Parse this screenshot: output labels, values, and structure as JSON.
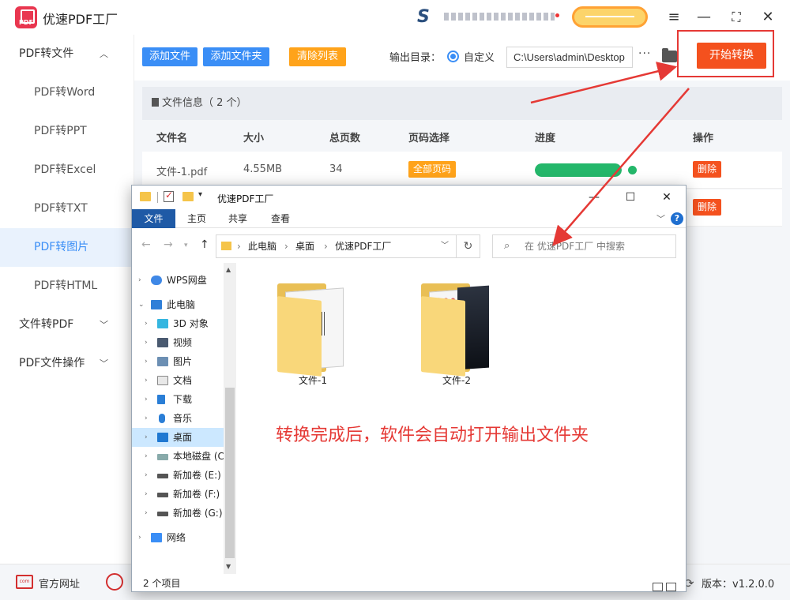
{
  "app": {
    "title": "优速PDF工厂",
    "version_label": "版本：v1.2.0.0"
  },
  "sidebar": {
    "groups": [
      {
        "label": "PDF转文件",
        "expanded": true
      },
      {
        "label": "文件转PDF",
        "expanded": false
      },
      {
        "label": "PDF文件操作",
        "expanded": false
      }
    ],
    "items": [
      "PDF转Word",
      "PDF转PPT",
      "PDF转Excel",
      "PDF转TXT",
      "PDF转图片",
      "PDF转HTML"
    ],
    "active_item": "PDF转图片"
  },
  "toolbar": {
    "add_file": "添加文件",
    "add_folder": "添加文件夹",
    "clear_list": "清除列表",
    "output_label": "输出目录：",
    "radio_label": "自定义",
    "output_path": "C:\\Users\\admin\\Desktop",
    "more": "···",
    "start": "开始转换"
  },
  "file_info": {
    "header": "文件信息（ 2 个）",
    "columns": [
      "文件名",
      "大小",
      "总页数",
      "页码选择",
      "进度",
      "操作"
    ],
    "rows": [
      {
        "name": "文件-1.pdf",
        "size": "4.55MB",
        "pages": "34",
        "page_select": "全部页码",
        "progress": 1.0,
        "action": "删除"
      },
      {
        "action": "删除"
      }
    ]
  },
  "footer": {
    "website": "官方网址"
  },
  "explorer": {
    "title": "优速PDF工厂",
    "ribbon_tabs": [
      "文件",
      "主页",
      "共享",
      "查看"
    ],
    "breadcrumb": [
      "此电脑",
      "桌面",
      "优速PDF工厂"
    ],
    "search_placeholder": "在 优速PDF工厂 中搜索",
    "tree": [
      {
        "label": "WPS网盘",
        "level": 0,
        "icon": "cloud-icon"
      },
      {
        "label": "此电脑",
        "level": 0,
        "icon": "computer-icon",
        "expanded": true
      },
      {
        "label": "3D 对象",
        "level": 1,
        "icon": "3d-objects-icon"
      },
      {
        "label": "视频",
        "level": 1,
        "icon": "video-icon"
      },
      {
        "label": "图片",
        "level": 1,
        "icon": "pictures-icon"
      },
      {
        "label": "文档",
        "level": 1,
        "icon": "documents-icon"
      },
      {
        "label": "下载",
        "level": 1,
        "icon": "download-icon"
      },
      {
        "label": "音乐",
        "level": 1,
        "icon": "music-icon"
      },
      {
        "label": "桌面",
        "level": 1,
        "icon": "desktop-icon",
        "selected": true
      },
      {
        "label": "本地磁盘 (C",
        "level": 1,
        "icon": "drive-c-icon"
      },
      {
        "label": "新加卷 (E:)",
        "level": 1,
        "icon": "drive-icon"
      },
      {
        "label": "新加卷 (F:)",
        "level": 1,
        "icon": "drive-icon"
      },
      {
        "label": "新加卷 (G:)",
        "level": 1,
        "icon": "drive-icon"
      },
      {
        "label": "网络",
        "level": 0,
        "icon": "network-icon"
      }
    ],
    "folders": [
      "文件-1",
      "文件-2"
    ],
    "annotation": "转换完成后，软件会自动打开输出文件夹",
    "status": "2 个项目"
  },
  "colors": {
    "accent_blue": "#3a8ef6",
    "orange": "#ffa31a",
    "start_red": "#f4511e",
    "progress_green": "#24b76a",
    "annotation_red": "#e53935"
  }
}
